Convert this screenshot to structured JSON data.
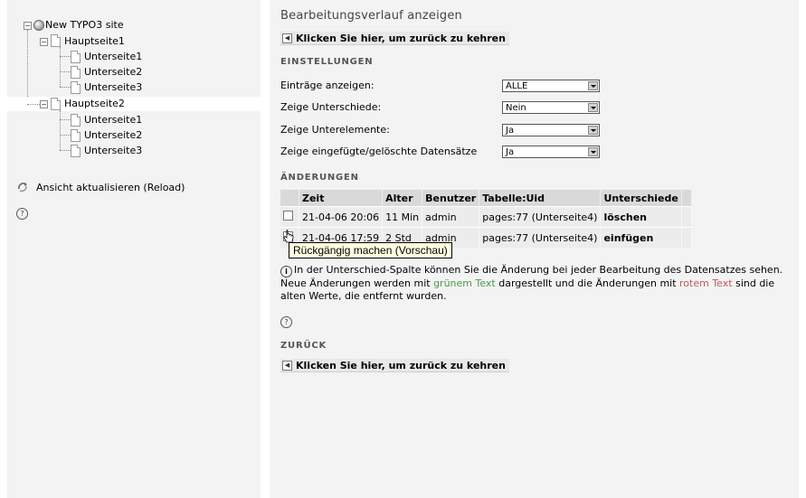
{
  "tree": {
    "root": "New TYPO3 site",
    "pages": [
      {
        "label": "Hauptseite1",
        "children": [
          "Unterseite1",
          "Unterseite2",
          "Unterseite3"
        ]
      },
      {
        "label": "Hauptseite2",
        "children": [
          "Unterseite1",
          "Unterseite2",
          "Unterseite3"
        ]
      }
    ]
  },
  "left_panel": {
    "reload_label": "Ansicht aktualisieren (Reload)",
    "help_icon": "?"
  },
  "main": {
    "title": "Bearbeitungsverlauf anzeigen",
    "back_label": "Klicken Sie hier, um zurück zu kehren",
    "settings_heading": "EINSTELLUNGEN",
    "settings": [
      {
        "label": "Einträge anzeigen:",
        "value": "ALLE"
      },
      {
        "label": "Zeige Unterschiede:",
        "value": "Nein"
      },
      {
        "label": "Zeige Unterelemente:",
        "value": "Ja"
      },
      {
        "label": "Zeige eingefügte/gelöschte Datensätze",
        "value": "Ja"
      }
    ],
    "changes_heading": "ÄNDERUNGEN",
    "table": {
      "headers": [
        "",
        "Zeit",
        "Alter",
        "Benutzer",
        "Tabelle:Uid",
        "Unterschiede",
        ""
      ],
      "rows": [
        {
          "time": "21-04-06 20:06",
          "age": "11 Min",
          "user": "admin",
          "table_uid": "pages:77 (Unterseite4)",
          "diff": "löschen"
        },
        {
          "time": "21-04-06 17:59",
          "age": "2 Std",
          "user": "admin",
          "table_uid": "pages:77 (Unterseite4)",
          "diff": "einfügen"
        }
      ]
    },
    "tooltip": "Rückgängig machen (Vorschau)",
    "info": {
      "part1": "In der Unterschied-Spalte können Sie die Änderung bei jeder Bearbeitung des Datensatzes sehen. Neue Änderungen werden mit ",
      "green_text": "grünem Text",
      "part2": " dargestellt und die Änderungen mit ",
      "red_text": "rotem Text",
      "part3": " sind die alten Werte, die entfernt wurden."
    },
    "back_heading": "ZURÜCK",
    "help_icon": "?"
  },
  "colors": {
    "panel_bg": "#f3f3f3",
    "green_text": "#4a9a4a",
    "red_text": "#c25a5a",
    "tooltip_bg": "#ffffe1"
  }
}
